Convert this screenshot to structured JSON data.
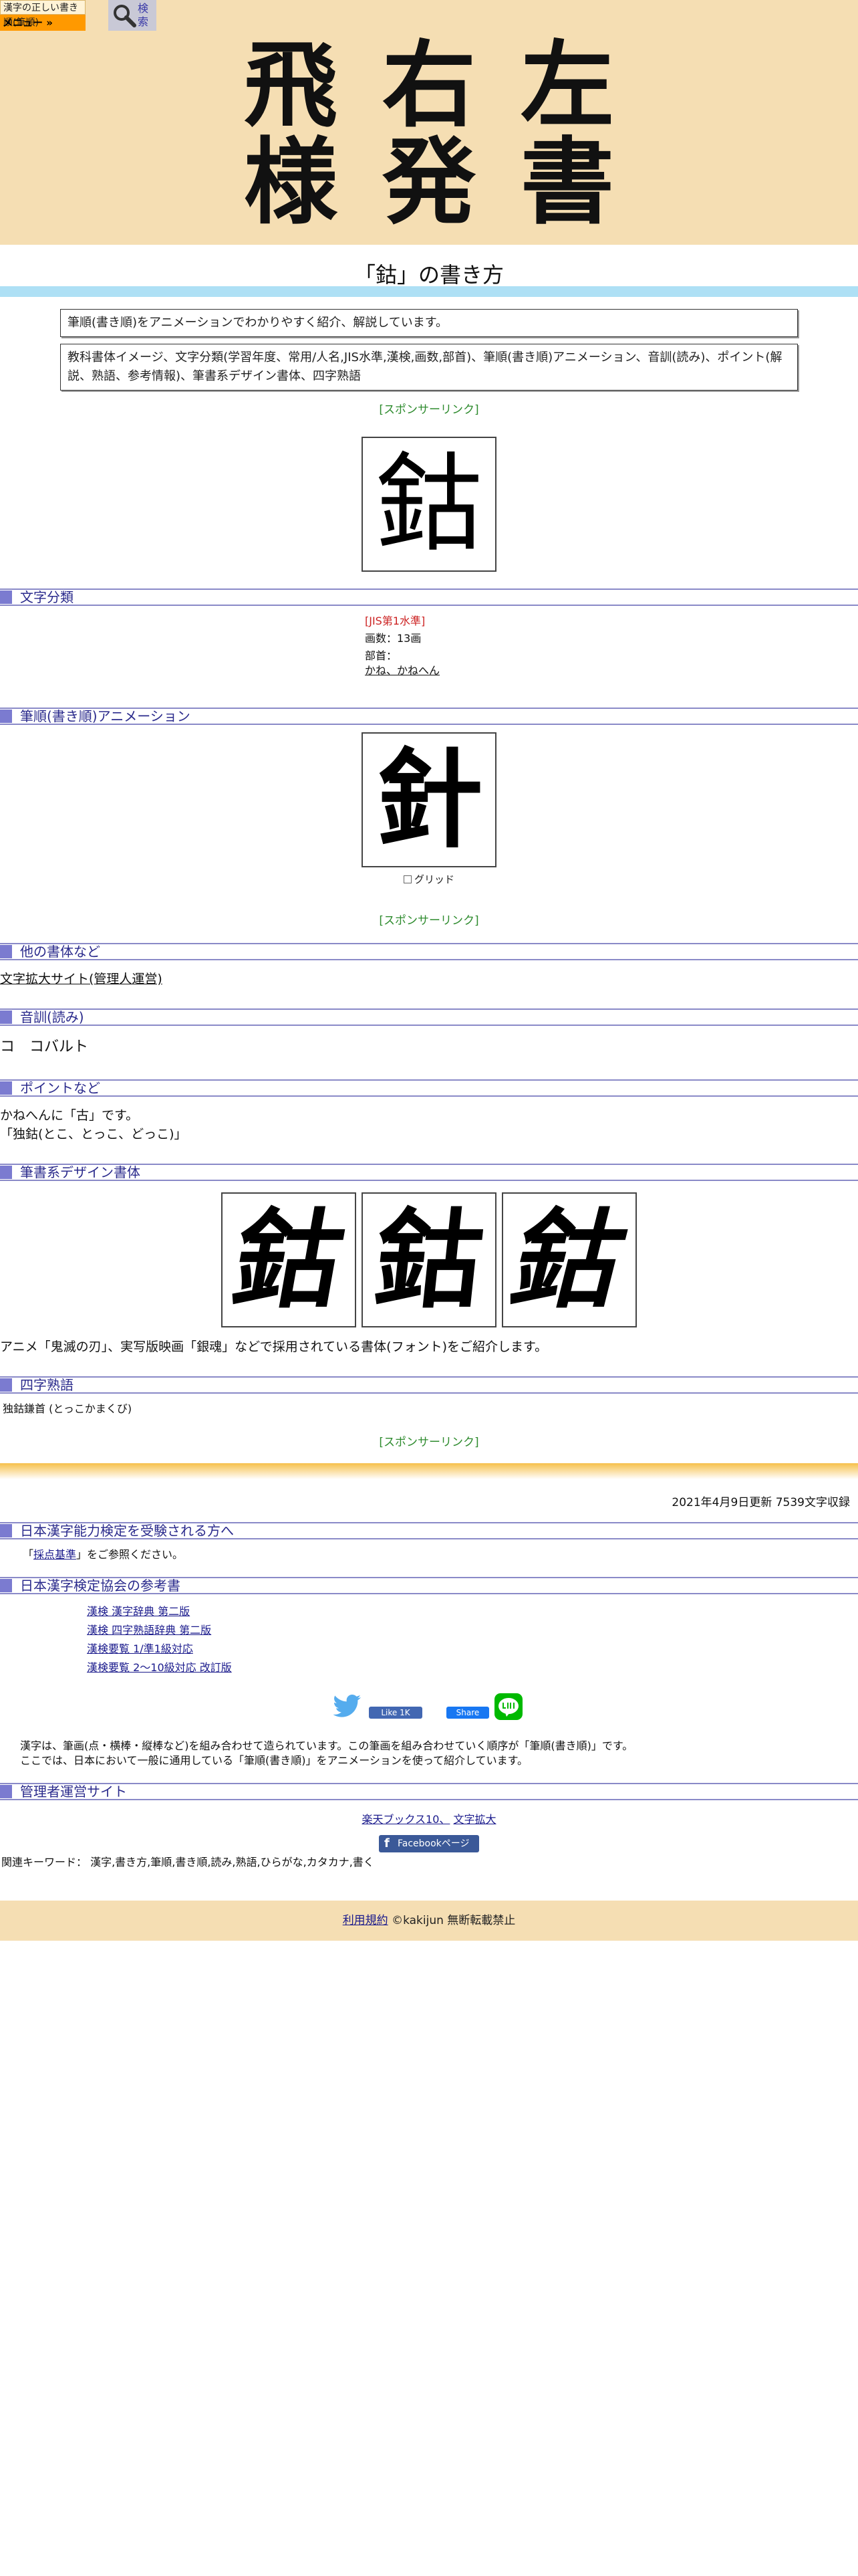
{
  "header": {
    "badge_top": "漢字の正しい書き順(筆順)",
    "badge_menu": "メニュー »",
    "search_label": "検索",
    "logo_chars": [
      "飛",
      "右",
      "左",
      "様",
      "発",
      "書"
    ]
  },
  "page_title": "「鈷」の書き方",
  "intro_note": "筆順(書き順)をアニメーションでわかりやすく紹介、解説しています。",
  "contents_note": "教科書体イメージ、文字分類(学習年度、常用/人名,JIS水準,漢検,画数,部首)、筆順(書き順)アニメーション、音訓(読み)、ポイント(解説、熟語、参考情報)、筆書系デザイン書体、四字熟語",
  "sponsor_link": "[スポンサーリンク]",
  "main_kanji": "鈷",
  "anim_kanji": "針",
  "sections": {
    "classification": "文字分類",
    "animation": "筆順(書き順)アニメーション",
    "other_fonts": "他の書体など",
    "readings": "音訓(読み)",
    "points": "ポイントなど",
    "brush_fonts": "筆書系デザイン書体",
    "yoji": "四字熟語",
    "kanken_exam": "日本漢字能力検定を受験される方へ",
    "kanken_books": "日本漢字検定協会の参考書",
    "admin_sites": "管理者運営サイト"
  },
  "classification": {
    "jis": "[JIS第1水準]",
    "strokes": "画数：13画",
    "radical_label": "部首：",
    "radical_link": "かね、かねへん"
  },
  "grid_label": "グリッド",
  "other_fonts_link": "文字拡大サイト(管理人運営)",
  "readings_text": "コ　コバルト",
  "points_lines": [
    "かねへんに「古」です。",
    "「独鈷(とこ、とっこ、どっこ)」"
  ],
  "brush_kanji": [
    "鈷",
    "鈷",
    "鈷"
  ],
  "brush_note": "アニメ「鬼滅の刃」、実写版映画「銀魂」などで採用されている書体(フォント)をご紹介します。",
  "yoji_text": "独鈷鎌首 (とっこかまくび)",
  "update_text": "2021年4月9日更新 7539文字収録",
  "kanken_exam": {
    "prefix": "「",
    "link": "採点基準",
    "suffix": "」をご参照ください。"
  },
  "kanken_books": [
    "漢検 漢字辞典 第二版",
    "漢検 四字熟語辞典 第二版",
    "漢検要覧 1/準1級対応",
    "漢検要覧 2～10級対応 改訂版"
  ],
  "social": {
    "like": "Like 1K",
    "share": "Share"
  },
  "about_lines": [
    "漢字は、筆画(点・横棒・縦棒など)を組み合わせて造られています。この筆画を組み合わせていく順序が「筆順(書き順)」です。",
    "ここでは、日本において一般に通用している「筆順(書き順)」をアニメーションを使って紹介しています。"
  ],
  "admin_links": [
    "楽天ブックス10、",
    "文字拡大"
  ],
  "fb_page": "Facebookページ",
  "keywords": "関連キーワード： 漢字,書き方,筆順,書き順,読み,熟語,ひらがな,カタカナ,書く",
  "footer": {
    "terms": "利用規約",
    "copyright": "©kakijun 無断転載禁止"
  },
  "colors": {
    "header_bg": "#f5deb3",
    "menu_orange": "#ff9900",
    "section_blue": "#7b7bd0",
    "sponsor_green": "#2e8b2e",
    "jis_red": "#cc2222"
  }
}
